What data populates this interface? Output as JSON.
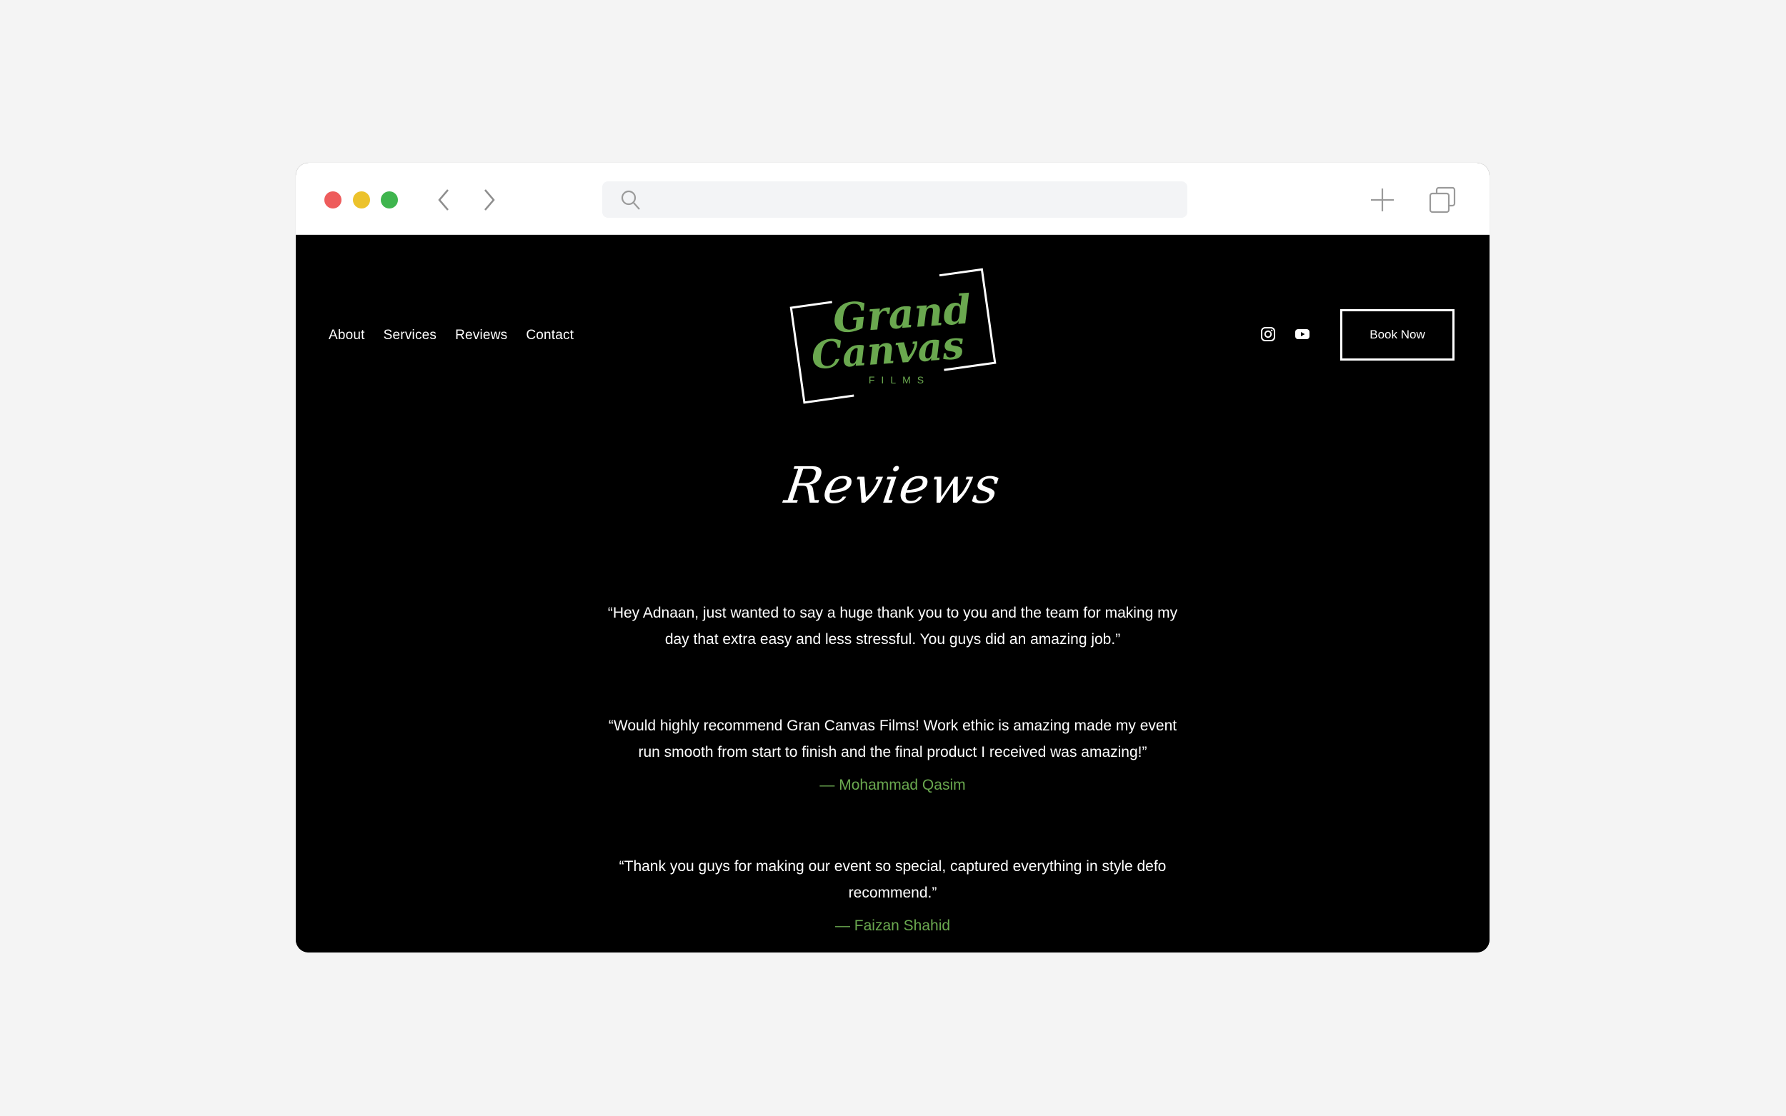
{
  "browser": {
    "traffic_lights": [
      "close",
      "minimize",
      "maximize"
    ],
    "back_icon": "chevron-left-icon",
    "forward_icon": "chevron-right-icon",
    "search": {
      "icon": "search-icon",
      "value": "",
      "placeholder": ""
    },
    "new_tab_icon": "plus-icon",
    "tabs_icon": "tabs-overview-icon"
  },
  "site": {
    "nav": [
      {
        "label": "About"
      },
      {
        "label": "Services"
      },
      {
        "label": "Reviews"
      },
      {
        "label": "Contact"
      }
    ],
    "logo": {
      "line1": "Grand",
      "line2": "Canvas",
      "subtitle": "FILMS"
    },
    "social": [
      {
        "name": "instagram-icon"
      },
      {
        "name": "youtube-icon"
      }
    ],
    "book_button": "Book Now",
    "heading": "Reviews",
    "reviews": [
      {
        "quote": "“Hey Adnaan, just wanted to say a huge thank you to you and the team for making my day that extra easy and less stressful. You guys did an amazing job.”",
        "author": ""
      },
      {
        "quote": "“Would highly recommend Gran Canvas Films! Work ethic is amazing made my event run smooth from start to finish and the final product I received was amazing!”",
        "author": "— Mohammad Qasim"
      },
      {
        "quote": "“Thank you guys for making our event so special, captured everything in style defo recommend.”",
        "author": "— Faizan Shahid"
      }
    ],
    "colors": {
      "background": "#000000",
      "text": "#ffffff",
      "accent_green": "#6aa84f"
    }
  }
}
